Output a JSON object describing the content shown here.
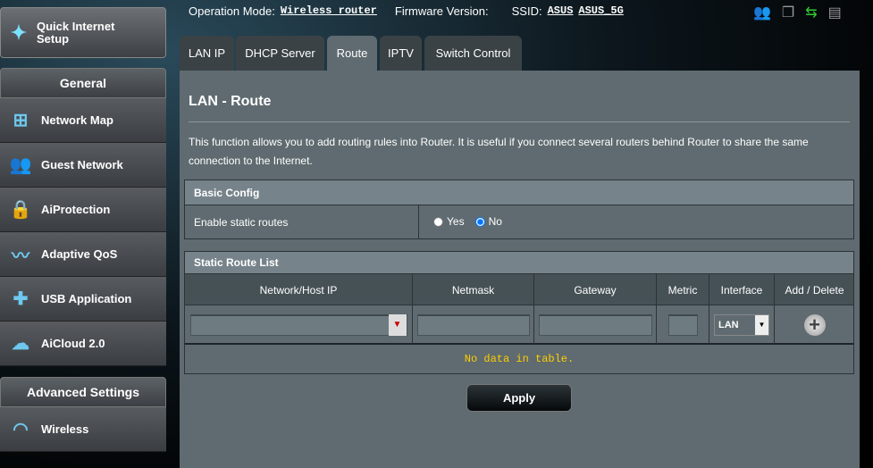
{
  "sidebar": {
    "quick_setup": "Quick Internet Setup",
    "general": "General",
    "items": [
      {
        "label": "Network Map",
        "icon": "network-map-icon"
      },
      {
        "label": "Guest Network",
        "icon": "guest-network-icon"
      },
      {
        "label": "AiProtection",
        "icon": "lock-icon"
      },
      {
        "label": "Adaptive QoS",
        "icon": "qos-icon"
      },
      {
        "label": "USB Application",
        "icon": "puzzle-icon"
      },
      {
        "label": "AiCloud 2.0",
        "icon": "cloud-icon"
      }
    ],
    "advanced": "Advanced Settings",
    "advanced_items": [
      {
        "label": "Wireless",
        "icon": "wifi-icon"
      }
    ]
  },
  "header": {
    "op_mode_label": "Operation Mode:",
    "op_mode": "Wireless router",
    "fw_label": "Firmware Version:",
    "ssid_label": "SSID:",
    "ssid1": "ASUS",
    "ssid2": "ASUS_5G",
    "status_icons": [
      "clients-icon",
      "devices-icon",
      "usb-icon",
      "printer-icon"
    ],
    "accent": "#33cc33"
  },
  "tabs": [
    {
      "label": "LAN IP"
    },
    {
      "label": "DHCP Server"
    },
    {
      "label": "Route",
      "active": true
    },
    {
      "label": "IPTV"
    },
    {
      "label": "Switch Control"
    }
  ],
  "main": {
    "title": "LAN - Route",
    "description": "This function allows you to add routing rules into Router. It is useful if you connect several routers behind Router to share the same connection to the Internet.",
    "basic_config": {
      "header": "Basic Config",
      "label": "Enable static routes",
      "yes": "Yes",
      "no": "No",
      "selected": "No"
    },
    "route_list": {
      "header": "Static Route List",
      "columns": [
        "Network/Host IP",
        "Netmask",
        "Gateway",
        "Metric",
        "Interface",
        "Add / Delete"
      ],
      "interface_value": "LAN",
      "empty": "No data in table."
    },
    "apply": "Apply"
  }
}
